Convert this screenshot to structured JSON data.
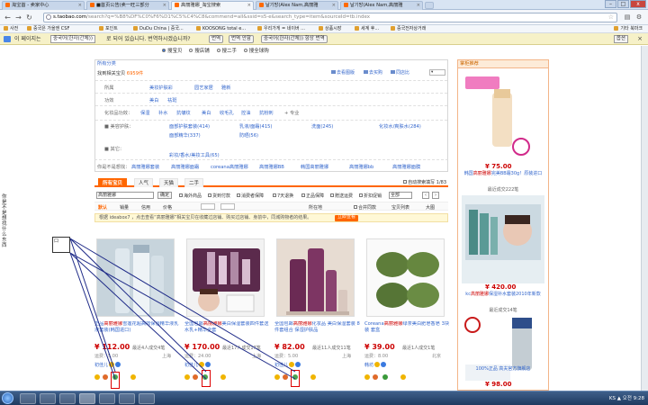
{
  "browser": {
    "tabs": [
      {
        "label": "淘宝首 - 卖家中心"
      },
      {
        "label": "■首页公告(卖一旺三部分"
      },
      {
        "label": "高丽雅娜_淘宝搜索"
      },
      {
        "label": "날기방(Alex Nam,高丽雅"
      },
      {
        "label": "날기방(Alex Nam,高丽雅"
      }
    ],
    "url_domain": "s.taobao.com",
    "url_rest": "/search?q=%B8%DF%C0%F6%D1%C5%C4%C8&commend=all&ssid=s5-e&search_type=item&sourceId=tb.index",
    "bookmarks": [
      "사전",
      "중국은 가을엔 CSF",
      "포인트",
      "DuDu China | 중국...",
      "KOOSONG total e...",
      "우리가게 = 네이버 ...",
      "상품시장",
      "세계 후...",
      "중국전자상거래"
    ],
    "bookmarks_other": "기타 북마크",
    "translate": {
      "msg": "이 페이지는",
      "lang": "중국어(한자(간체))",
      "msg2": "로 되어 있습니다. 번역하시겠습니까?",
      "btn_translate": "번역",
      "btn_no": "번역 안함",
      "btn_always": "중국어(한자(간체)) 항상 번역",
      "options": "옵션"
    },
    "window": {
      "min": "–",
      "max": "□",
      "close": "x"
    }
  },
  "search": {
    "scope": [
      "搜宝贝",
      "搜店铺",
      "搜二手",
      "搜全球购"
    ],
    "category_title": "所有分类",
    "all_label": "找到相关宝贝",
    "all_count": "6959件",
    "mini_tools": [
      "去看图版",
      "去买购",
      "同店比"
    ],
    "rows": [
      {
        "label": "所属",
        "values": [
          "美妆护肤彩",
          "园艺家居",
          "雅新"
        ]
      },
      {
        "label": "功效",
        "values": [
          "美白",
          "祛斑"
        ]
      },
      {
        "label": "化妆品功效：",
        "values": [
          "保湿",
          "补水",
          "抗皱纹",
          "美白",
          "收毛孔",
          "控油",
          "抗粉刺"
        ]
      }
    ],
    "more": "+ 专业",
    "sub_lines": [
      {
        "label": "■ 美容护肤：",
        "items": [
          "面部护肤套装(414)",
          "乳液/面霜(415)",
          "洗面(245)",
          "化妆水/爽肤水(284)"
        ]
      },
      {
        "label": "",
        "items": [
          "面部精华(337)",
          "防晒(56)"
        ]
      },
      {
        "label": "■ 其它：",
        "items": [
          "彩妆/香水/美妆工具(65)"
        ]
      }
    ],
    "also_label": "你是不是想找：",
    "also": [
      "高丽雅娜套装",
      "高丽雅娜面霜",
      "coreana高丽雅娜",
      "高丽雅娜BB",
      "韩国高丽雅娜",
      "高丽雅娜bb",
      "高丽雅娜面膜"
    ],
    "tabs": [
      "所有宝贝",
      "人气",
      "天猫",
      "二手"
    ],
    "tabs_right": "自动搜索填写",
    "page_info": "1/83",
    "keyword": "高丽雅娜",
    "confirm": "确定",
    "checks": [
      "海外商品",
      "货到付款",
      "消费者保障",
      "7天退换",
      "正品保障",
      "赠送运费",
      "折扣促销"
    ],
    "all_select": "全部",
    "sorts": [
      "默认",
      "销量",
      "信用",
      "价格"
    ],
    "sort_right": [
      "所在地",
      "合并同款",
      "宝贝列表",
      "大图"
    ],
    "tip": "根据 ideabox7 ，点击查看“高丽雅娜”相关宝贝在收藏过店铺、购买过店铺、身前中，同城购物者的结果。",
    "tip_btn": "立即查看"
  },
  "products": [
    {
      "title_a": "正品",
      "title_hl": "高丽雅娜",
      "title_b": "雪莲花超高效保湿精华液乳液套装(韩国进口)",
      "price": "¥ 112.00",
      "sales": "最近4人成交4笔",
      "ship": "运费：5.00",
      "loc": "上海",
      "seller": "初佳儿"
    },
    {
      "title_a": "全国包邮",
      "title_hl": "高丽雅娜",
      "title_b": "美白保湿套装四件套送水乳+精华全套",
      "price": "¥ 170.00",
      "sales": "最近17人成交17笔",
      "ship": "运费：24.00",
      "loc": "上海",
      "seller": "初佳儿"
    },
    {
      "title_a": "全国包邮",
      "title_hl": "高丽雅娜",
      "title_b": "化妆品 美白保湿套装 8件套组合 保湿护肤品",
      "price": "¥ 82.00",
      "sales": "最近11人成交11笔",
      "ship": "运费：5.00",
      "loc": "上海",
      "seller": "初佳儿"
    },
    {
      "title_a": "Coreana",
      "title_hl": "高丽雅娜",
      "title_b": "绿茶美白肥皂香皂 3块装 套盒",
      "price": "¥ 39.00",
      "sales": "最近1人成交1笔",
      "ship": "运费：8.00",
      "loc": "北京",
      "seller": "韩坊"
    }
  ],
  "sidebar": {
    "header": "掌柜推荐",
    "items": [
      {
        "price": "¥ 75.00",
        "title_a": "韩国",
        "title_hl": "高丽雅娜",
        "title_b": "完美BB霜30g！原装进口",
        "sales": "最近成交222笔"
      },
      {
        "price": "¥ 420.00",
        "title_a": "kc",
        "title_hl": "高丽雅娜",
        "title_b": "保湿补水套装2010年新款",
        "sales": "最近成交14笔"
      },
      {
        "price": "¥ 98.00",
        "title_a": "",
        "title_hl": "",
        "title_b": "100%正品 高夫官方旗舰店",
        "sales": ""
      }
    ]
  },
  "overlay": {
    "vertical_text": "你是不是想找什么东西",
    "box_label": "口"
  },
  "taskbar": {
    "time": "오전 9:28",
    "lang": "KS"
  }
}
